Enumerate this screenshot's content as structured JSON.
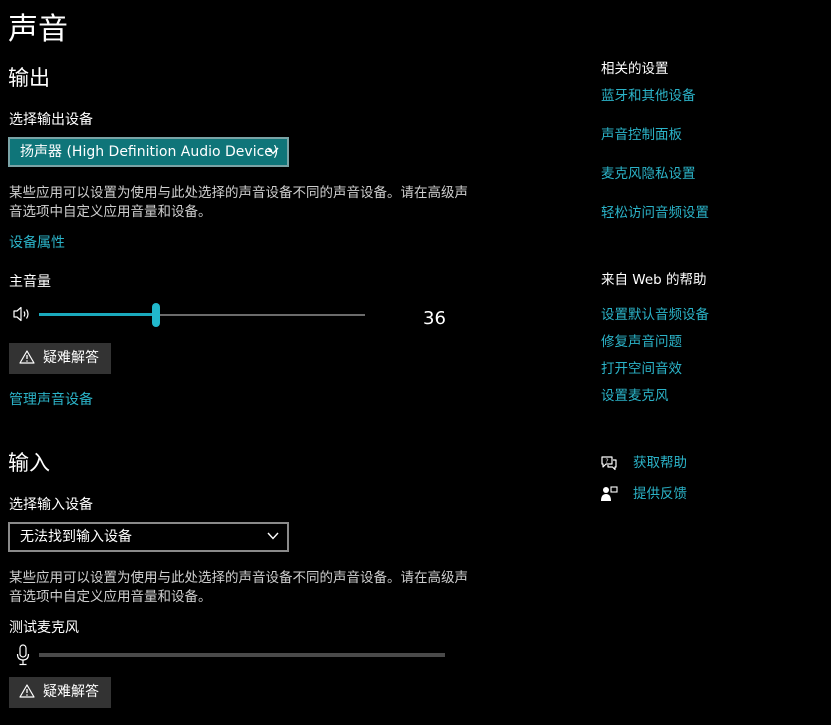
{
  "page_title": "声音",
  "output": {
    "heading": "输出",
    "device_label": "选择输出设备",
    "device_value": "扬声器 (High Definition Audio Device)",
    "description": "某些应用可以设置为使用与此处选择的声音设备不同的声音设备。请在高级声音选项中自定义应用音量和设备。",
    "properties_link": "设备属性",
    "volume_label": "主音量",
    "volume_value": "36",
    "volume_level": 0.36,
    "troubleshoot_label": "疑难解答",
    "manage_link": "管理声音设备"
  },
  "input": {
    "heading": "输入",
    "device_label": "选择输入设备",
    "device_value": "无法找到输入设备",
    "description": "某些应用可以设置为使用与此处选择的声音设备不同的声音设备。请在高级声音选项中自定义应用音量和设备。",
    "test_mic_label": "测试麦克风",
    "mic_level": 0,
    "troubleshoot_label": "疑难解答"
  },
  "related": {
    "heading": "相关的设置",
    "links": [
      "蓝牙和其他设备",
      "声音控制面板",
      "麦克风隐私设置",
      "轻松访问音频设置"
    ]
  },
  "web_help": {
    "heading": "来自 Web 的帮助",
    "links": [
      "设置默认音频设备",
      "修复声音问题",
      "打开空间音效",
      "设置麦克风"
    ]
  },
  "support": {
    "get_help": "获取帮助",
    "feedback": "提供反馈"
  },
  "colors": {
    "accent": "#2bb3c8",
    "dropdown_selected": "#0f7579",
    "background": "#000000"
  },
  "icons": {
    "speaker": "speaker-icon",
    "microphone": "microphone-icon",
    "warning": "warning-icon",
    "chevron": "chevron-down-icon",
    "help": "help-chat-icon",
    "feedback": "feedback-icon"
  }
}
